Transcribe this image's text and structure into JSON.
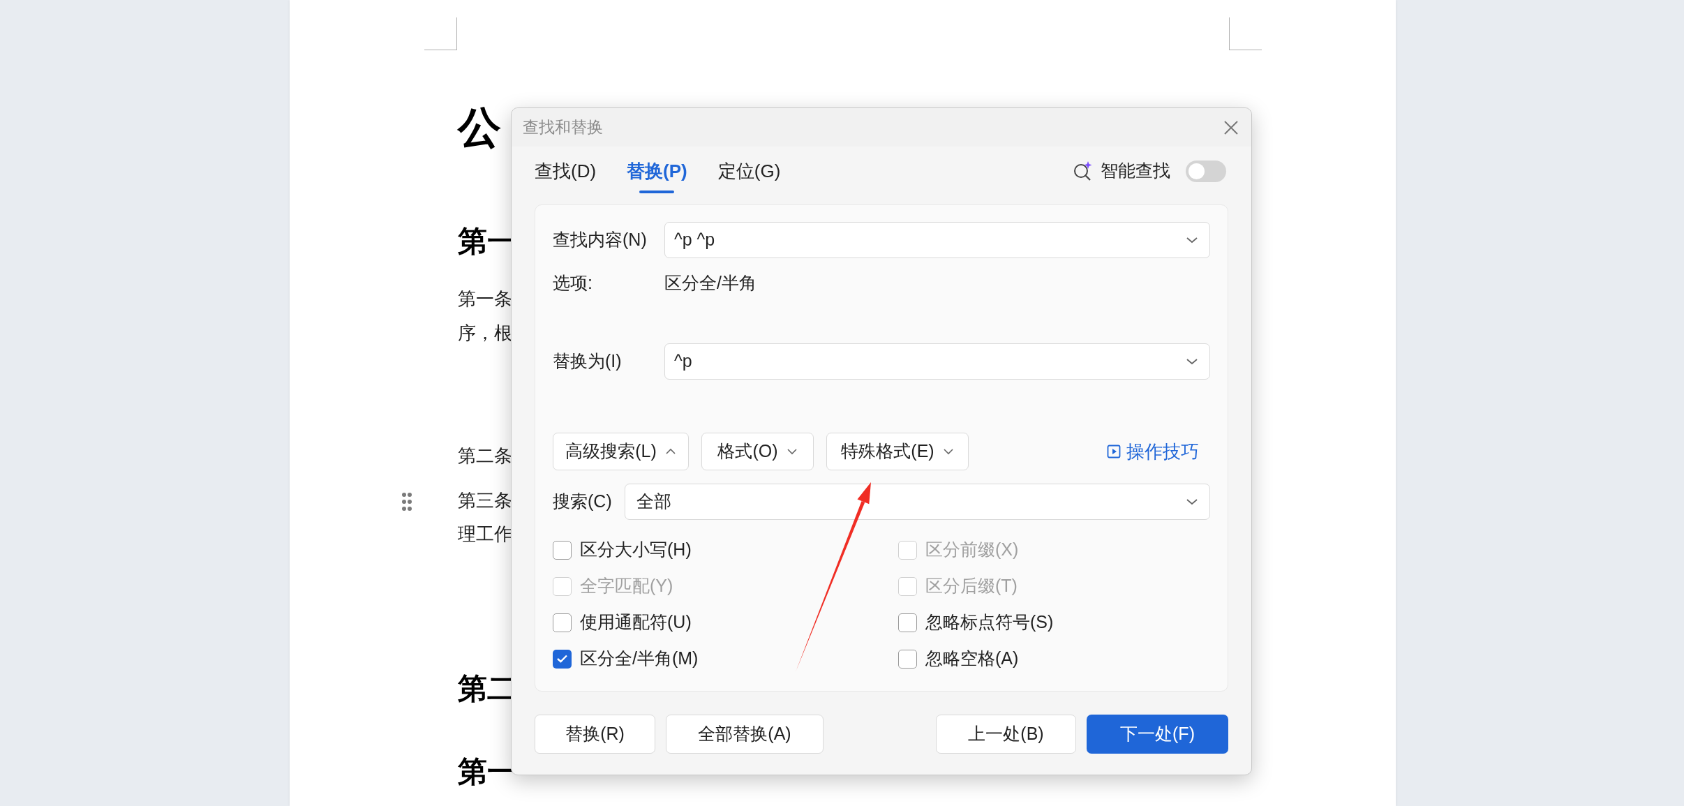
{
  "document": {
    "blocks": [
      {
        "kind": "title",
        "text": "公"
      },
      {
        "kind": "heading",
        "text": "第一"
      },
      {
        "kind": "para",
        "text": "第一条"
      },
      {
        "kind": "para",
        "text": "序，根"
      },
      {
        "kind": "para",
        "text": "第二条"
      },
      {
        "kind": "para",
        "text": "第三条"
      },
      {
        "kind": "para",
        "text": "理工作"
      },
      {
        "kind": "heading",
        "text": "第二"
      },
      {
        "kind": "heading",
        "text": "第一"
      }
    ]
  },
  "dialog": {
    "title": "查找和替换",
    "tabs": [
      {
        "label": "查找(D)",
        "selected": false
      },
      {
        "label": "替换(P)",
        "selected": true
      },
      {
        "label": "定位(G)",
        "selected": false
      }
    ],
    "smart_find": {
      "label": "智能查找",
      "on": false
    },
    "find": {
      "label": "查找内容(N)",
      "value": "^p ^p"
    },
    "options": {
      "label": "选项:",
      "value": "区分全/半角"
    },
    "replace": {
      "label": "替换为(I)",
      "value": "^p"
    },
    "menu_buttons": [
      {
        "label": "高级搜索(L)",
        "expanded": true
      },
      {
        "label": "格式(O)",
        "expanded": false
      },
      {
        "label": "特殊格式(E)",
        "expanded": false
      }
    ],
    "tips_link": "操作技巧",
    "search": {
      "label": "搜索(C)",
      "value": "全部"
    },
    "checkboxes": [
      {
        "label": "区分大小写(H)",
        "checked": false,
        "disabled": false
      },
      {
        "label": "全字匹配(Y)",
        "checked": false,
        "disabled": true
      },
      {
        "label": "使用通配符(U)",
        "checked": false,
        "disabled": false
      },
      {
        "label": "区分全/半角(M)",
        "checked": true,
        "disabled": false
      },
      {
        "label": "区分前缀(X)",
        "checked": false,
        "disabled": true
      },
      {
        "label": "区分后缀(T)",
        "checked": false,
        "disabled": true
      },
      {
        "label": "忽略标点符号(S)",
        "checked": false,
        "disabled": false
      },
      {
        "label": "忽略空格(A)",
        "checked": false,
        "disabled": false
      }
    ],
    "buttons": [
      {
        "label": "替换(R)",
        "primary": false
      },
      {
        "label": "全部替换(A)",
        "primary": false
      },
      {
        "label": "上一处(B)",
        "primary": false
      },
      {
        "label": "下一处(F)",
        "primary": true
      }
    ]
  }
}
